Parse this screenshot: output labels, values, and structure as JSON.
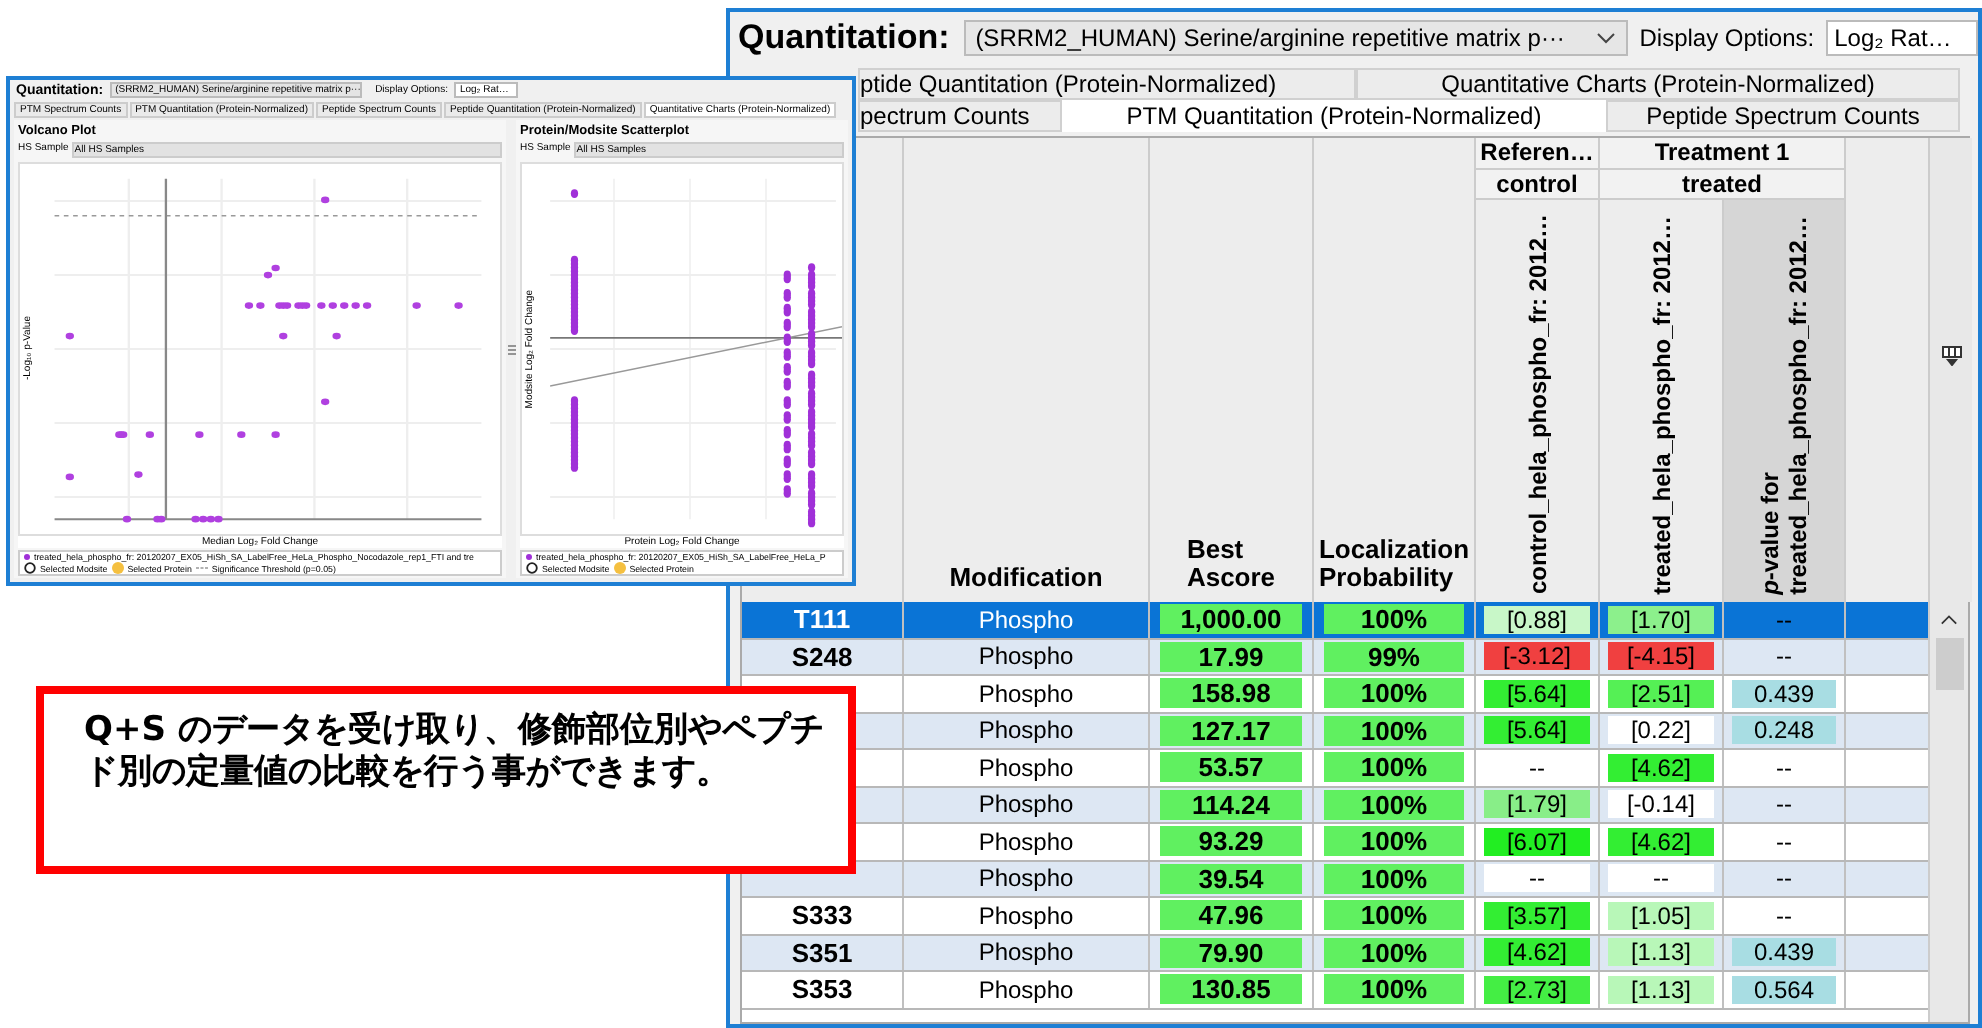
{
  "main_window": {
    "quantitation_label": "Quantitation:",
    "protein_dropdown": "(SRRM2_HUMAN) Serine/arginine repetitive matrix p···",
    "display_options_label": "Display Options:",
    "display_options_value": "Log₂ Rat…",
    "tab_rows": [
      [
        {
          "label": "ptide Quantitation (Protein-Normalized)",
          "selected": false
        },
        {
          "label": "Quantitative Charts (Protein-Normalized)",
          "selected": false
        }
      ],
      [
        {
          "label": "pectrum Counts",
          "selected": false
        },
        {
          "label": "PTM Quantitation (Protein-Normalized)",
          "selected": true
        },
        {
          "label": "Peptide Spectrum Counts",
          "selected": false
        }
      ]
    ],
    "table": {
      "columns": [
        "Modification",
        "Best\nAscore",
        "Localization\nProbability"
      ],
      "groups": [
        {
          "label": "Referen…",
          "sub": "control",
          "columns": [
            {
              "label": "control_hela_phospho_fr: 2012…",
              "highlighted": false
            }
          ]
        },
        {
          "label": "Treatment 1",
          "sub": "treated",
          "columns": [
            {
              "label": "treated_hela_phospho_fr: 2012…",
              "highlighted": false
            },
            {
              "label": "*p*-value for\ntreated_hela_phospho_fr: 2012…",
              "highlighted": true
            }
          ]
        }
      ],
      "rows": [
        {
          "site": "T111",
          "selected": true,
          "modification": "Phospho",
          "ascore": "1,000.00",
          "probability": "100%",
          "values": [
            {
              "text": "[0.88]",
              "color": "#c8f7c8"
            },
            {
              "text": "[1.70]",
              "color": "#8cf08c"
            },
            {
              "text": "--"
            }
          ]
        },
        {
          "site": "S248",
          "selected": false,
          "modification": "Phospho",
          "ascore": "17.99",
          "probability": "99%",
          "values": [
            {
              "text": "[-3.12]",
              "color": "#f04040"
            },
            {
              "text": "[-4.15]",
              "color": "#f04040"
            },
            {
              "text": "--"
            }
          ]
        },
        {
          "selected": false,
          "modification": "Phospho",
          "ascore": "158.98",
          "probability": "100%",
          "values": [
            {
              "text": "[5.64]",
              "color": "#33ee33"
            },
            {
              "text": "[2.51]",
              "color": "#55f055"
            },
            {
              "text": "0.439",
              "color": "#a8dde3"
            }
          ]
        },
        {
          "selected": false,
          "modification": "Phospho",
          "ascore": "127.17",
          "probability": "100%",
          "values": [
            {
              "text": "[5.64]",
              "color": "#33ee33"
            },
            {
              "text": "[0.22]",
              "color": "#ffffff"
            },
            {
              "text": "0.248",
              "color": "#a8dde3"
            }
          ]
        },
        {
          "selected": false,
          "modification": "Phospho",
          "ascore": "53.57",
          "probability": "100%",
          "values": [
            {
              "text": "--"
            },
            {
              "text": "[4.62]",
              "color": "#33ee33"
            },
            {
              "text": "--"
            }
          ]
        },
        {
          "selected": false,
          "modification": "Phospho",
          "ascore": "114.24",
          "probability": "100%",
          "values": [
            {
              "text": "[1.79]",
              "color": "#88ee88"
            },
            {
              "text": "[-0.14]",
              "color": "#ffffff"
            },
            {
              "text": "--"
            }
          ]
        },
        {
          "selected": false,
          "modification": "Phospho",
          "ascore": "93.29",
          "probability": "100%",
          "values": [
            {
              "text": "[6.07]",
              "color": "#22ee22"
            },
            {
              "text": "[4.62]",
              "color": "#33ee33"
            },
            {
              "text": "--"
            }
          ]
        },
        {
          "selected": false,
          "modification": "Phospho",
          "ascore": "39.54",
          "probability": "100%",
          "values": [
            {
              "text": "--",
              "color": "#ffffff"
            },
            {
              "text": "--",
              "color": "#ffffff"
            },
            {
              "text": "--"
            }
          ]
        },
        {
          "site": "S333",
          "selected": false,
          "modification": "Phospho",
          "ascore": "47.96",
          "probability": "100%",
          "values": [
            {
              "text": "[3.57]",
              "color": "#33ee33"
            },
            {
              "text": "[1.05]",
              "color": "#b8f7b8"
            },
            {
              "text": "--"
            }
          ]
        },
        {
          "site": "S351",
          "selected": false,
          "modification": "Phospho",
          "ascore": "79.90",
          "probability": "100%",
          "values": [
            {
              "text": "[4.62]",
              "color": "#33ee33"
            },
            {
              "text": "[1.13]",
              "color": "#b8f7b8"
            },
            {
              "text": "0.439",
              "color": "#a8dde3"
            }
          ]
        },
        {
          "site": "S353",
          "selected": false,
          "modification": "Phospho",
          "ascore": "130.85",
          "probability": "100%",
          "values": [
            {
              "text": "[2.73]",
              "color": "#44ee44"
            },
            {
              "text": "[1.13]",
              "color": "#b8f7b8"
            },
            {
              "text": "0.564",
              "color": "#a8dde3"
            }
          ]
        }
      ]
    }
  },
  "inset_window": {
    "quantitation_label": "Quantitation:",
    "protein_dropdown": "(SRRM2_HUMAN) Serine/arginine repetitive matrix p···",
    "display_options_label": "Display Options:",
    "display_options_value": "Log₂ Rat…",
    "tabs": [
      {
        "label": "PTM Spectrum Counts",
        "selected": false
      },
      {
        "label": "PTM Quantitation (Protein-Normalized)",
        "selected": false
      },
      {
        "label": "Peptide Spectrum Counts",
        "selected": false
      },
      {
        "label": "Peptide Quantitation (Protein-Normalized)",
        "selected": false
      },
      {
        "label": "Quantitative Charts (Protein-Normalized)",
        "selected": true
      }
    ],
    "panels": [
      {
        "kind": "volcano",
        "title": "Volcano Plot",
        "sample_label": "HS Sample",
        "sample_value": "All HS Samples",
        "xlabel": "Median Log₂ Fold Change",
        "ylabel": "-Log₁₀ p-Value",
        "legend_series": "treated_hela_phospho_fr: 20120207_EX05_HiSh_SA_LabelFree_HeLa_Phospho_Nocodazole_rep1_FTI and tre",
        "legend_items": [
          {
            "kind": "ring",
            "label": "Selected Modsite"
          },
          {
            "kind": "dot",
            "label": "Selected Protein"
          },
          {
            "kind": "dash",
            "label": "Significance Threshold (p=0.05)"
          }
        ]
      },
      {
        "kind": "scatter",
        "title": "Protein/Modsite Scatterplot",
        "sample_label": "HS Sample",
        "sample_value": "All HS Samples",
        "xlabel": "Protein Log₂ Fold Change",
        "ylabel": "Modsite Log₂ Fold Change",
        "legend_series": "treated_hela_phospho_fr: 20120207_EX05_HiSh_SA_LabelFree_HeLa_P",
        "legend_items": [
          {
            "kind": "ring",
            "label": "Selected Modsite"
          },
          {
            "kind": "dot",
            "label": "Selected Protein"
          }
        ]
      }
    ]
  },
  "callout": {
    "text": "Q+S のデータを受け取り、修飾部位別やペプチド別の定量値の比較を行う事ができます。"
  }
}
